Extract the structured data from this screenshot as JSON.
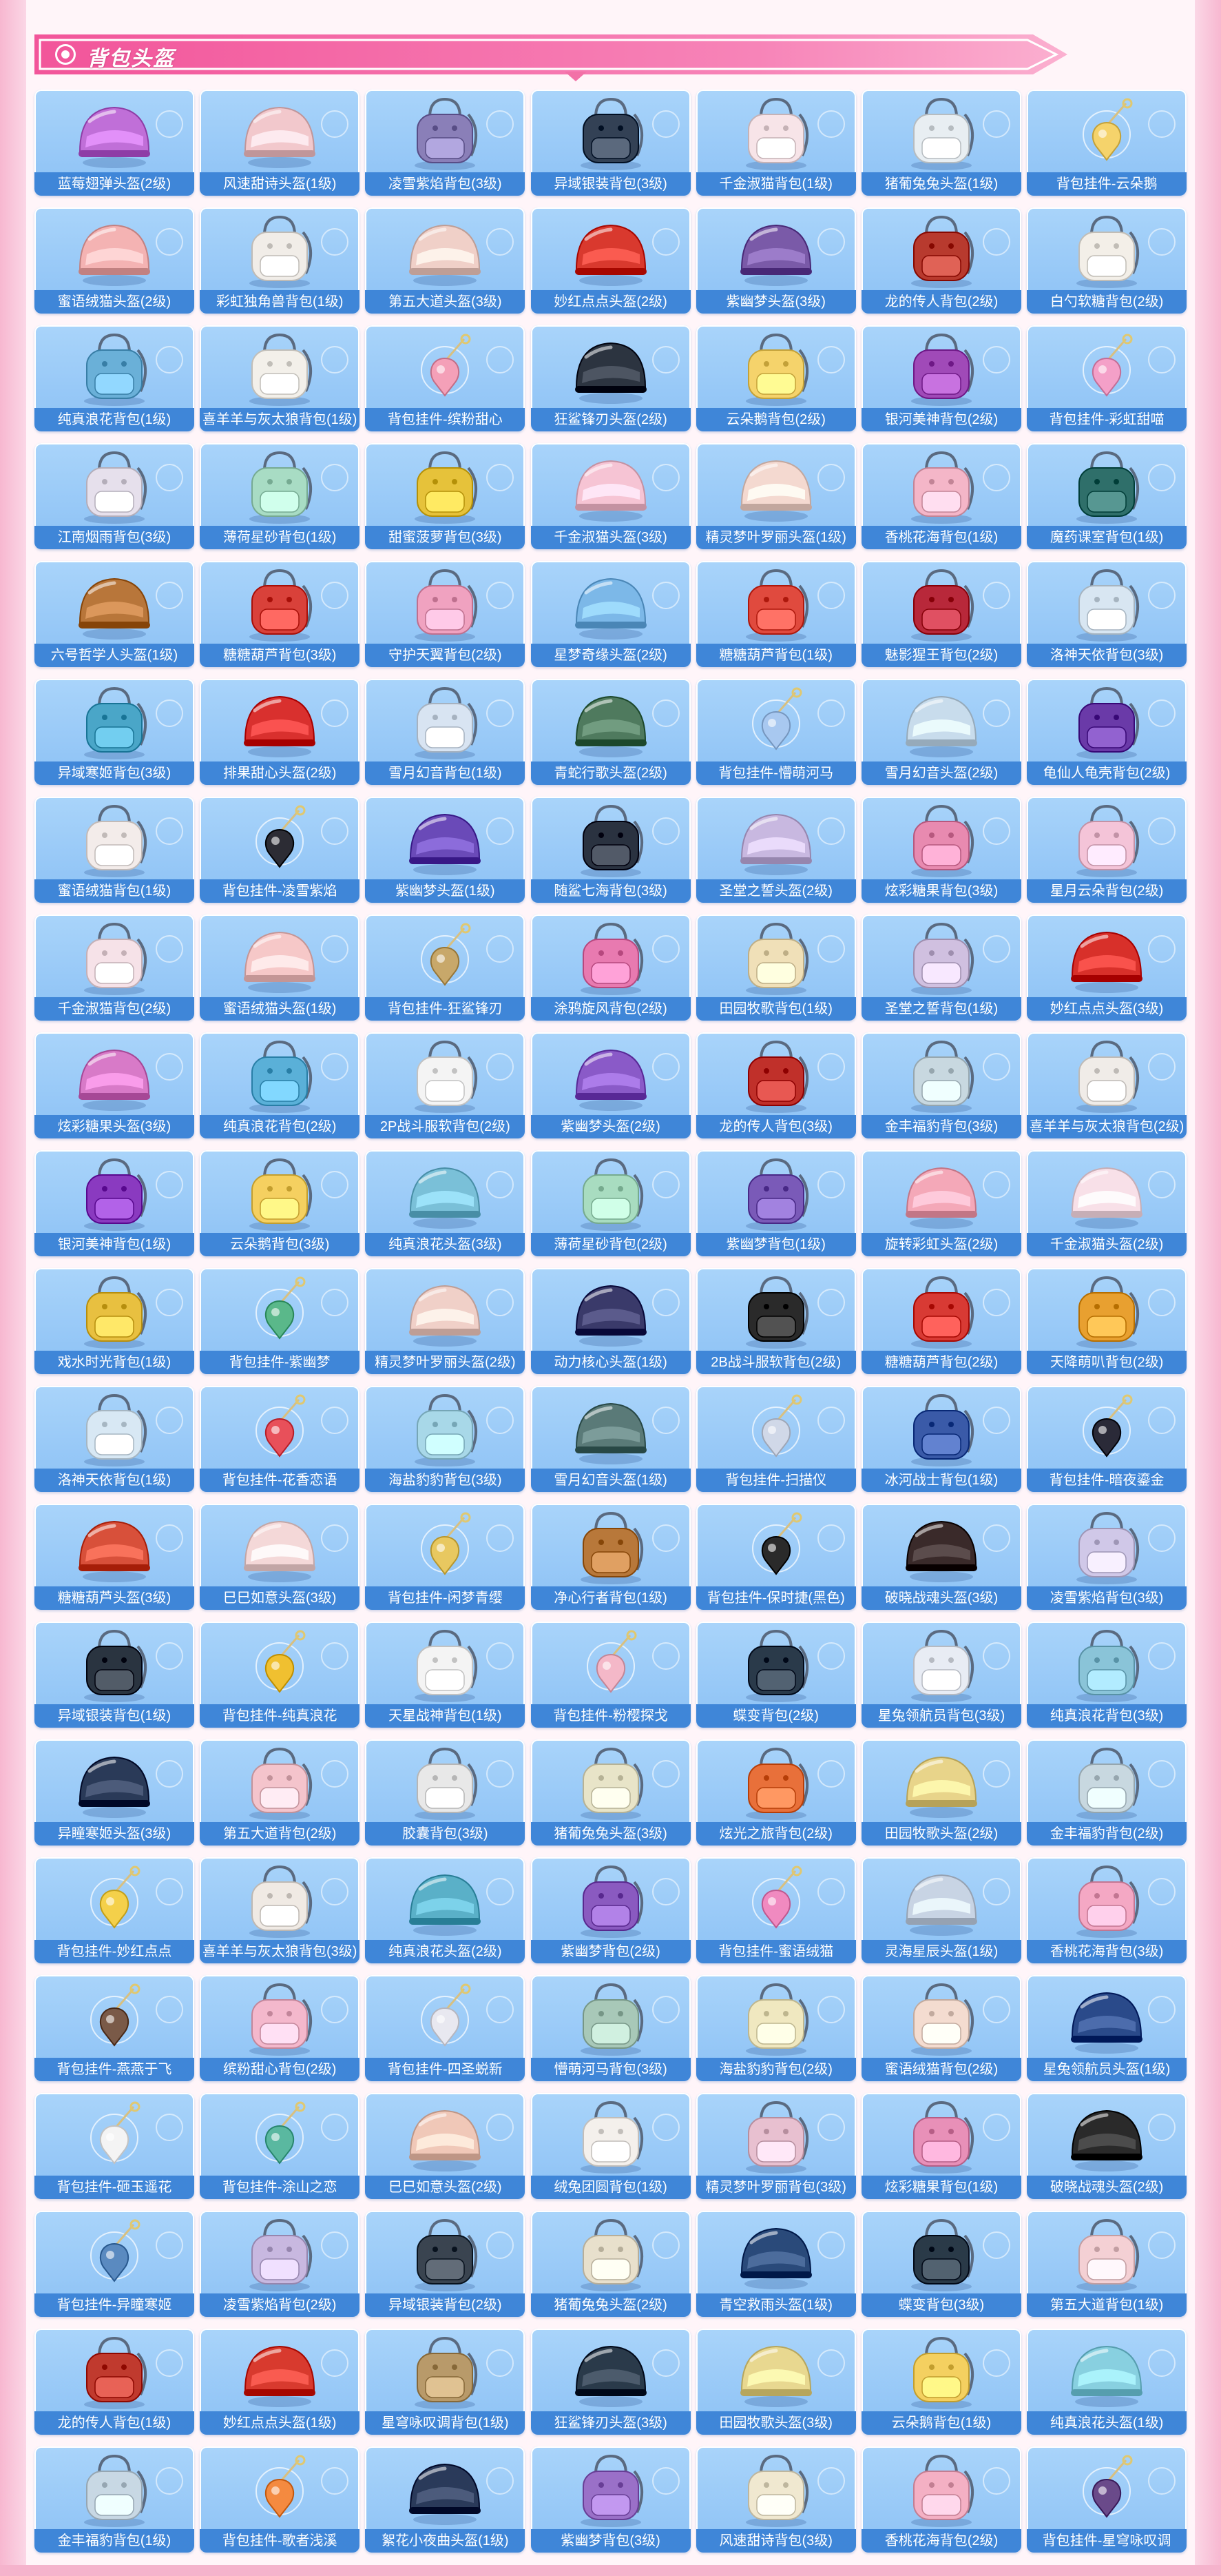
{
  "header": {
    "title": "背包头盔"
  },
  "colors": {
    "card_bg": "#9ccbf7",
    "caption_bg": "#3f86d8",
    "banner": "#f26ea8"
  },
  "items": [
    {
      "label": "蓝莓翅弹头盔(2级)",
      "icon": "helmet-icon",
      "color": "#c06fd8"
    },
    {
      "label": "风速甜诗头盔(1级)",
      "icon": "helmet-icon",
      "color": "#f2c8cc"
    },
    {
      "label": "凌雪紫焰背包(3级)",
      "icon": "backpack-icon",
      "color": "#8a7fb8"
    },
    {
      "label": "异域银装背包(3级)",
      "icon": "backpack-icon",
      "color": "#334155"
    },
    {
      "label": "千金淑猫背包(1级)",
      "icon": "backpack-icon",
      "color": "#f7e4e8"
    },
    {
      "label": "猪葡兔兔头盔(1级)",
      "icon": "backpack-icon",
      "color": "#e8eef2"
    },
    {
      "label": "背包挂件-云朵鹅",
      "icon": "charm-icon",
      "color": "#f5d36b"
    },
    {
      "label": "蜜语绒猫头盔(2级)",
      "icon": "helmet-icon",
      "color": "#f4b3b3"
    },
    {
      "label": "彩虹独角兽背包(1级)",
      "icon": "backpack-icon",
      "color": "#f1ede8"
    },
    {
      "label": "第五大道头盔(3级)",
      "icon": "helmet-icon",
      "color": "#f0d0c8"
    },
    {
      "label": "妙红点点头盔(2级)",
      "icon": "helmet-icon",
      "color": "#d9392e"
    },
    {
      "label": "紫幽梦头盔(3级)",
      "icon": "helmet-icon",
      "color": "#7a5aa8"
    },
    {
      "label": "龙的传人背包(2级)",
      "icon": "backpack-icon",
      "color": "#b83a2e"
    },
    {
      "label": "白勺软糖背包(2级)",
      "icon": "backpack-icon",
      "color": "#f3efe8"
    },
    {
      "label": "纯真浪花背包(1级)",
      "icon": "backpack-icon",
      "color": "#6ab0d8"
    },
    {
      "label": "喜羊羊与灰太狼背包(1级)",
      "icon": "backpack-icon",
      "color": "#f3f0ea"
    },
    {
      "label": "背包挂件-缤粉甜心",
      "icon": "charm-icon",
      "color": "#f4a0b8"
    },
    {
      "label": "狂鲨锋刃头盔(2级)",
      "icon": "helmet-icon",
      "color": "#2c3440"
    },
    {
      "label": "云朵鹅背包(2级)",
      "icon": "backpack-icon",
      "color": "#f5d36b"
    },
    {
      "label": "银河美神背包(2级)",
      "icon": "backpack-icon",
      "color": "#a04ab8"
    },
    {
      "label": "背包挂件-彩虹甜喵",
      "icon": "charm-icon",
      "color": "#f4a0c8"
    },
    {
      "label": "江南烟雨背包(3级)",
      "icon": "backpack-icon",
      "color": "#e6e0ec"
    },
    {
      "label": "薄荷星砂背包(1级)",
      "icon": "backpack-icon",
      "color": "#a8dcc4"
    },
    {
      "label": "甜蜜菠萝背包(3级)",
      "icon": "backpack-icon",
      "color": "#e6c23a"
    },
    {
      "label": "千金淑猫头盔(3级)",
      "icon": "helmet-icon",
      "color": "#f6c4d4"
    },
    {
      "label": "精灵梦叶罗丽头盔(1级)",
      "icon": "helmet-icon",
      "color": "#f4d9d0"
    },
    {
      "label": "香桃花海背包(1级)",
      "icon": "backpack-icon",
      "color": "#f4b6c8"
    },
    {
      "label": "魔药课室背包(1级)",
      "icon": "backpack-icon",
      "color": "#2f6f6a"
    },
    {
      "label": "六号哲学人头盔(1级)",
      "icon": "helmet-icon",
      "color": "#b8763a"
    },
    {
      "label": "糖糖葫芦背包(3级)",
      "icon": "backpack-icon",
      "color": "#d9413a"
    },
    {
      "label": "守护天翼背包(2级)",
      "icon": "backpack-icon",
      "color": "#f0a2c0"
    },
    {
      "label": "星梦奇缘头盔(2级)",
      "icon": "helmet-icon",
      "color": "#7cb8e8"
    },
    {
      "label": "糖糖葫芦背包(1级)",
      "icon": "backpack-icon",
      "color": "#e04a3e"
    },
    {
      "label": "魅影猩王背包(2级)",
      "icon": "backpack-icon",
      "color": "#b8283a"
    },
    {
      "label": "洛神天依背包(3级)",
      "icon": "backpack-icon",
      "color": "#d8e6f2"
    },
    {
      "label": "异域寒姬背包(3级)",
      "icon": "backpack-icon",
      "color": "#4aa6c8"
    },
    {
      "label": "排果甜心头盔(2级)",
      "icon": "helmet-icon",
      "color": "#d9302e"
    },
    {
      "label": "雪月幻音背包(1级)",
      "icon": "backpack-icon",
      "color": "#d8e4f2"
    },
    {
      "label": "青蛇行歌头盔(2级)",
      "icon": "helmet-icon",
      "color": "#4f7a5e"
    },
    {
      "label": "背包挂件-懵萌河马",
      "icon": "charm-icon",
      "color": "#a8c8f0"
    },
    {
      "label": "雪月幻音头盔(2级)",
      "icon": "helmet-icon",
      "color": "#c8dcec"
    },
    {
      "label": "龟仙人龟壳背包(2级)",
      "icon": "backpack-icon",
      "color": "#6a3aa8"
    },
    {
      "label": "蜜语绒猫背包(1级)",
      "icon": "backpack-icon",
      "color": "#f3ecea"
    },
    {
      "label": "背包挂件-凌雪紫焰",
      "icon": "charm-icon",
      "color": "#2c2c34"
    },
    {
      "label": "紫幽梦头盔(1级)",
      "icon": "helmet-icon",
      "color": "#6a4ab8"
    },
    {
      "label": "随鲨七海背包(3级)",
      "icon": "backpack-icon",
      "color": "#2a3240"
    },
    {
      "label": "圣堂之誓头盔(2级)",
      "icon": "helmet-icon",
      "color": "#c8b8e0"
    },
    {
      "label": "炫彩糖果背包(3级)",
      "icon": "backpack-icon",
      "color": "#e88ab0"
    },
    {
      "label": "星月云朵背包(2级)",
      "icon": "backpack-icon",
      "color": "#f4c4d8"
    },
    {
      "label": "千金淑猫背包(2级)",
      "icon": "backpack-icon",
      "color": "#f6e2e8"
    },
    {
      "label": "蜜语绒猫头盔(1级)",
      "icon": "helmet-icon",
      "color": "#f6c8c8"
    },
    {
      "label": "背包挂件-狂鲨锋刃",
      "icon": "charm-icon",
      "color": "#c8a86a"
    },
    {
      "label": "涂鸦旋风背包(2级)",
      "icon": "backpack-icon",
      "color": "#e87ab0"
    },
    {
      "label": "田园牧歌背包(1级)",
      "icon": "backpack-icon",
      "color": "#f0e0b8"
    },
    {
      "label": "圣堂之誓背包(1级)",
      "icon": "backpack-icon",
      "color": "#d0c0e0"
    },
    {
      "label": "妙红点点头盔(3级)",
      "icon": "helmet-icon",
      "color": "#d8302a"
    },
    {
      "label": "炫彩糖果头盔(3级)",
      "icon": "helmet-icon",
      "color": "#d87ac8"
    },
    {
      "label": "纯真浪花背包(2级)",
      "icon": "backpack-icon",
      "color": "#5ab0d8"
    },
    {
      "label": "2P战斗服软背包(2级)",
      "icon": "backpack-icon",
      "color": "#f4f4f4"
    },
    {
      "label": "紫幽梦头盔(2级)",
      "icon": "helmet-icon",
      "color": "#8a5ac8"
    },
    {
      "label": "龙的传人背包(3级)",
      "icon": "backpack-icon",
      "color": "#c0302a"
    },
    {
      "label": "金丰福豹背包(3级)",
      "icon": "backpack-icon",
      "color": "#c8d8e0"
    },
    {
      "label": "喜羊羊与灰太狼背包(2级)",
      "icon": "backpack-icon",
      "color": "#f0ece8"
    },
    {
      "label": "银河美神背包(1级)",
      "icon": "backpack-icon",
      "color": "#8a3ac0"
    },
    {
      "label": "云朵鹅背包(3级)",
      "icon": "backpack-icon",
      "color": "#f5d060"
    },
    {
      "label": "纯真浪花头盔(3级)",
      "icon": "helmet-icon",
      "color": "#7ac0d8"
    },
    {
      "label": "薄荷星砂背包(2级)",
      "icon": "backpack-icon",
      "color": "#a8dcc0"
    },
    {
      "label": "紫幽梦背包(1级)",
      "icon": "backpack-icon",
      "color": "#7a5ab8"
    },
    {
      "label": "旋转彩虹头盔(2级)",
      "icon": "helmet-icon",
      "color": "#f4a8b8"
    },
    {
      "label": "千金淑猫头盔(2级)",
      "icon": "helmet-icon",
      "color": "#f8e0e8"
    },
    {
      "label": "戏水时光背包(1级)",
      "icon": "backpack-icon",
      "color": "#e8c040"
    },
    {
      "label": "背包挂件-紫幽梦",
      "icon": "charm-icon",
      "color": "#5ab88a"
    },
    {
      "label": "精灵梦叶罗丽头盔(2级)",
      "icon": "helmet-icon",
      "color": "#f0d0c8"
    },
    {
      "label": "动力核心头盔(1级)",
      "icon": "helmet-icon",
      "color": "#3a3a6a"
    },
    {
      "label": "2B战斗服软背包(2级)",
      "icon": "backpack-icon",
      "color": "#2a2a2a"
    },
    {
      "label": "糖糖葫芦背包(2级)",
      "icon": "backpack-icon",
      "color": "#d83a34"
    },
    {
      "label": "天降萌叭背包(2级)",
      "icon": "backpack-icon",
      "color": "#e8a030"
    },
    {
      "label": "洛神天依背包(1级)",
      "icon": "backpack-icon",
      "color": "#d8e8f4"
    },
    {
      "label": "背包挂件-花香恋语",
      "icon": "charm-icon",
      "color": "#e8505a"
    },
    {
      "label": "海盐豹豹背包(3级)",
      "icon": "backpack-icon",
      "color": "#a8d8e8"
    },
    {
      "label": "雪月幻音头盔(1级)",
      "icon": "helmet-icon",
      "color": "#5a7a78"
    },
    {
      "label": "背包挂件-扫描仪",
      "icon": "charm-icon",
      "color": "#d0d8e8"
    },
    {
      "label": "冰河战士背包(1级)",
      "icon": "backpack-icon",
      "color": "#3a5aa8"
    },
    {
      "label": "背包挂件-暗夜鎏金",
      "icon": "charm-icon",
      "color": "#2a2a38"
    },
    {
      "label": "糖糖葫芦头盔(3级)",
      "icon": "helmet-icon",
      "color": "#d8503a"
    },
    {
      "label": "巳巳如意头盔(3级)",
      "icon": "helmet-icon",
      "color": "#f4d8d8"
    },
    {
      "label": "背包挂件-闲梦青缨",
      "icon": "charm-icon",
      "color": "#e8c860"
    },
    {
      "label": "净心行者背包(1级)",
      "icon": "backpack-icon",
      "color": "#b8783a"
    },
    {
      "label": "背包挂件-保时捷(黑色)",
      "icon": "charm-icon",
      "color": "#2a2a2a"
    },
    {
      "label": "破晓战魂头盔(3级)",
      "icon": "helmet-icon",
      "color": "#3a2a2a"
    },
    {
      "label": "凌雪紫焰背包(3级)",
      "icon": "backpack-icon",
      "color": "#d0c8e8"
    },
    {
      "label": "异域银装背包(1级)",
      "icon": "backpack-icon",
      "color": "#2a3440"
    },
    {
      "label": "背包挂件-纯真浪花",
      "icon": "charm-icon",
      "color": "#f0c030"
    },
    {
      "label": "天星战神背包(1级)",
      "icon": "backpack-icon",
      "color": "#f4f4f4"
    },
    {
      "label": "背包挂件-粉樱探戈",
      "icon": "charm-icon",
      "color": "#f4b8c8"
    },
    {
      "label": "蝶变背包(2级)",
      "icon": "backpack-icon",
      "color": "#2a3a4a"
    },
    {
      "label": "星兔领航员背包(3级)",
      "icon": "backpack-icon",
      "color": "#e8ecf4"
    },
    {
      "label": "纯真浪花背包(3级)",
      "icon": "backpack-icon",
      "color": "#8ac4d8"
    },
    {
      "label": "异瞳寒姬头盔(3级)",
      "icon": "helmet-icon",
      "color": "#2a3a58"
    },
    {
      "label": "第五大道背包(2级)",
      "icon": "backpack-icon",
      "color": "#f4c4cc"
    },
    {
      "label": "胶囊背包(3级)",
      "icon": "backpack-icon",
      "color": "#e8e8e8"
    },
    {
      "label": "猪葡兔兔头盔(3级)",
      "icon": "backpack-icon",
      "color": "#e8e4c8"
    },
    {
      "label": "炫光之旅背包(2级)",
      "icon": "backpack-icon",
      "color": "#e8703a"
    },
    {
      "label": "田园牧歌头盔(2级)",
      "icon": "helmet-icon",
      "color": "#e8d48a"
    },
    {
      "label": "金丰福豹背包(2级)",
      "icon": "backpack-icon",
      "color": "#c8d8e0"
    },
    {
      "label": "背包挂件-妙红点点",
      "icon": "charm-icon",
      "color": "#f4d04a"
    },
    {
      "label": "喜羊羊与灰太狼背包(3级)",
      "icon": "backpack-icon",
      "color": "#f0eae4"
    },
    {
      "label": "纯真浪花头盔(2级)",
      "icon": "helmet-icon",
      "color": "#5ab0c8"
    },
    {
      "label": "紫幽梦背包(2级)",
      "icon": "backpack-icon",
      "color": "#8a5ac0"
    },
    {
      "label": "背包挂件-蜜语绒猫",
      "icon": "charm-icon",
      "color": "#f08ac0"
    },
    {
      "label": "灵海星辰头盔(1级)",
      "icon": "helmet-icon",
      "color": "#c8d4e4"
    },
    {
      "label": "香桃花海背包(3级)",
      "icon": "backpack-icon",
      "color": "#f4a8c4"
    },
    {
      "label": "背包挂件-燕燕于飞",
      "icon": "charm-icon",
      "color": "#7a5a48"
    },
    {
      "label": "缤粉甜心背包(2级)",
      "icon": "backpack-icon",
      "color": "#f4b8cc"
    },
    {
      "label": "背包挂件-四圣蜕新",
      "icon": "charm-icon",
      "color": "#e8e8f0"
    },
    {
      "label": "懵萌河马背包(3级)",
      "icon": "backpack-icon",
      "color": "#a8c8b8"
    },
    {
      "label": "海盐豹豹背包(2级)",
      "icon": "backpack-icon",
      "color": "#f0e8c0"
    },
    {
      "label": "蜜语绒猫背包(2级)",
      "icon": "backpack-icon",
      "color": "#f4dcd0"
    },
    {
      "label": "星兔领航员头盔(1级)",
      "icon": "helmet-icon",
      "color": "#2a4a8a"
    },
    {
      "label": "背包挂件-砸玉遥花",
      "icon": "charm-icon",
      "color": "#f4f4f4"
    },
    {
      "label": "背包挂件-涂山之恋",
      "icon": "charm-icon",
      "color": "#5ab8a0"
    },
    {
      "label": "巳巳如意头盔(2级)",
      "icon": "helmet-icon",
      "color": "#f0c8b8"
    },
    {
      "label": "绒兔团圆背包(1级)",
      "icon": "backpack-icon",
      "color": "#f4f0ec"
    },
    {
      "label": "精灵梦叶罗丽背包(3级)",
      "icon": "backpack-icon",
      "color": "#e8c0d0"
    },
    {
      "label": "炫彩糖果背包(1级)",
      "icon": "backpack-icon",
      "color": "#e890b8"
    },
    {
      "label": "破晓战魂头盔(2级)",
      "icon": "helmet-icon",
      "color": "#2a2a2a"
    },
    {
      "label": "背包挂件-异瞳寒姬",
      "icon": "charm-icon",
      "color": "#5a8ac0"
    },
    {
      "label": "凌雪紫焰背包(2级)",
      "icon": "backpack-icon",
      "color": "#c8b8e0"
    },
    {
      "label": "异域银装背包(2级)",
      "icon": "backpack-icon",
      "color": "#3a4450"
    },
    {
      "label": "猪葡兔兔头盔(2级)",
      "icon": "backpack-icon",
      "color": "#e8e0cc"
    },
    {
      "label": "青空救雨头盔(1级)",
      "icon": "helmet-icon",
      "color": "#2a4a7a"
    },
    {
      "label": "蝶变背包(3级)",
      "icon": "backpack-icon",
      "color": "#2a3a48"
    },
    {
      "label": "第五大道背包(1级)",
      "icon": "backpack-icon",
      "color": "#f4d0d4"
    },
    {
      "label": "龙的传人背包(1级)",
      "icon": "backpack-icon",
      "color": "#c03a2e"
    },
    {
      "label": "妙红点点头盔(1级)",
      "icon": "helmet-icon",
      "color": "#d83a2e"
    },
    {
      "label": "星穹咏叹调背包(1级)",
      "icon": "backpack-icon",
      "color": "#b89a6a"
    },
    {
      "label": "狂鲨锋刃头盔(3级)",
      "icon": "helmet-icon",
      "color": "#2a3a4a"
    },
    {
      "label": "田园牧歌头盔(3级)",
      "icon": "helmet-icon",
      "color": "#e8d890"
    },
    {
      "label": "云朵鹅背包(1级)",
      "icon": "backpack-icon",
      "color": "#f4d060"
    },
    {
      "label": "纯真浪花头盔(1级)",
      "icon": "helmet-icon",
      "color": "#88d0e0"
    },
    {
      "label": "金丰福豹背包(1级)",
      "icon": "backpack-icon",
      "color": "#c8d8e4"
    },
    {
      "label": "背包挂件-歌者浅溪",
      "icon": "charm-icon",
      "color": "#f48a40"
    },
    {
      "label": "絮花小夜曲头盔(1级)",
      "icon": "helmet-icon",
      "color": "#2a3a5a"
    },
    {
      "label": "紫幽梦背包(3级)",
      "icon": "backpack-icon",
      "color": "#9a70c8"
    },
    {
      "label": "风速甜诗背包(3级)",
      "icon": "backpack-icon",
      "color": "#f0e8d0"
    },
    {
      "label": "香桃花海背包(2级)",
      "icon": "backpack-icon",
      "color": "#f4b0c4"
    },
    {
      "label": "背包挂件-星穹咏叹调",
      "icon": "charm-icon",
      "color": "#6a4a8a"
    }
  ]
}
